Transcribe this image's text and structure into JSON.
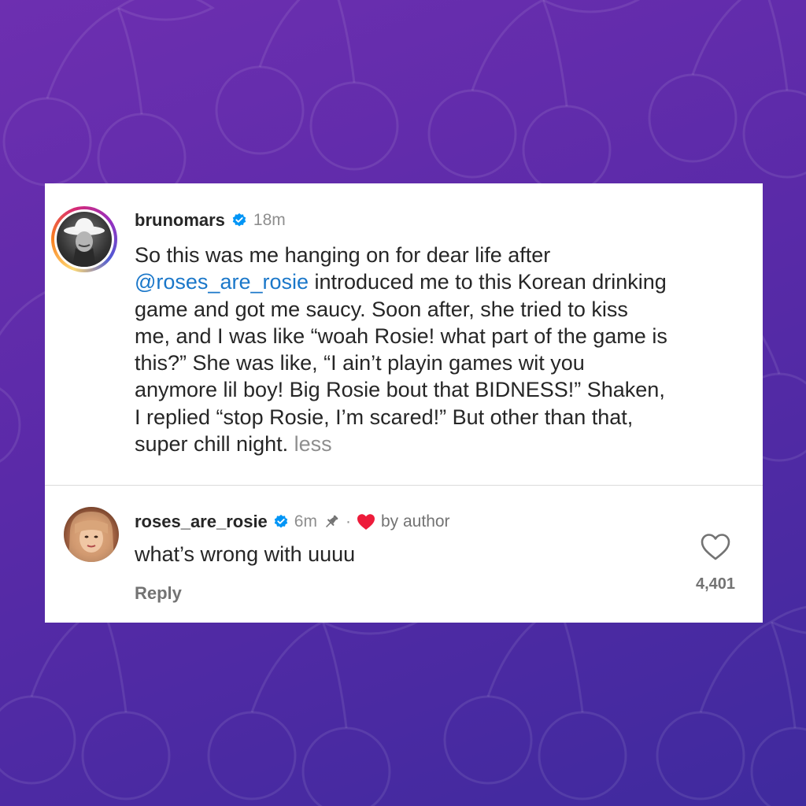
{
  "post": {
    "username": "brunomars",
    "time": "18m",
    "caption": {
      "line1": "So this was me hanging on for dear life after",
      "mention": "@roses_are_rosie",
      "line2_rest": " introduced me to this Korean drinking",
      "line3": "game and got me saucy. Soon after, she tried to kiss",
      "line4": "me, and I was like “woah Rosie! what part of the game is",
      "line5": "this?” She was like, “I ain’t playin games wit you",
      "line6": "anymore lil boy! Big Rosie bout that BIDNESS!” Shaken,",
      "line7": "I replied “stop Rosie, I’m scared!” But other than that,",
      "line8": "super chill night.",
      "less_label": "less"
    }
  },
  "comment": {
    "username": "roses_are_rosie",
    "time": "6m",
    "separator": "·",
    "by_author_label": "by author",
    "text": "what’s wrong with uuuu",
    "reply_label": "Reply",
    "like_count": "4,401"
  },
  "icons": {
    "verified": "verified-badge-icon",
    "pin": "pin-icon",
    "heart_filled": "heart-filled-icon",
    "like": "heart-outline-icon"
  },
  "colors": {
    "background_start": "#6d2fb0",
    "background_end": "#3f2a9e",
    "verified_blue": "#0095f6",
    "mention_blue": "#1a77c9",
    "heart_red": "#ed1b3a",
    "text_primary": "#262626",
    "text_secondary": "#8e8e8e"
  }
}
